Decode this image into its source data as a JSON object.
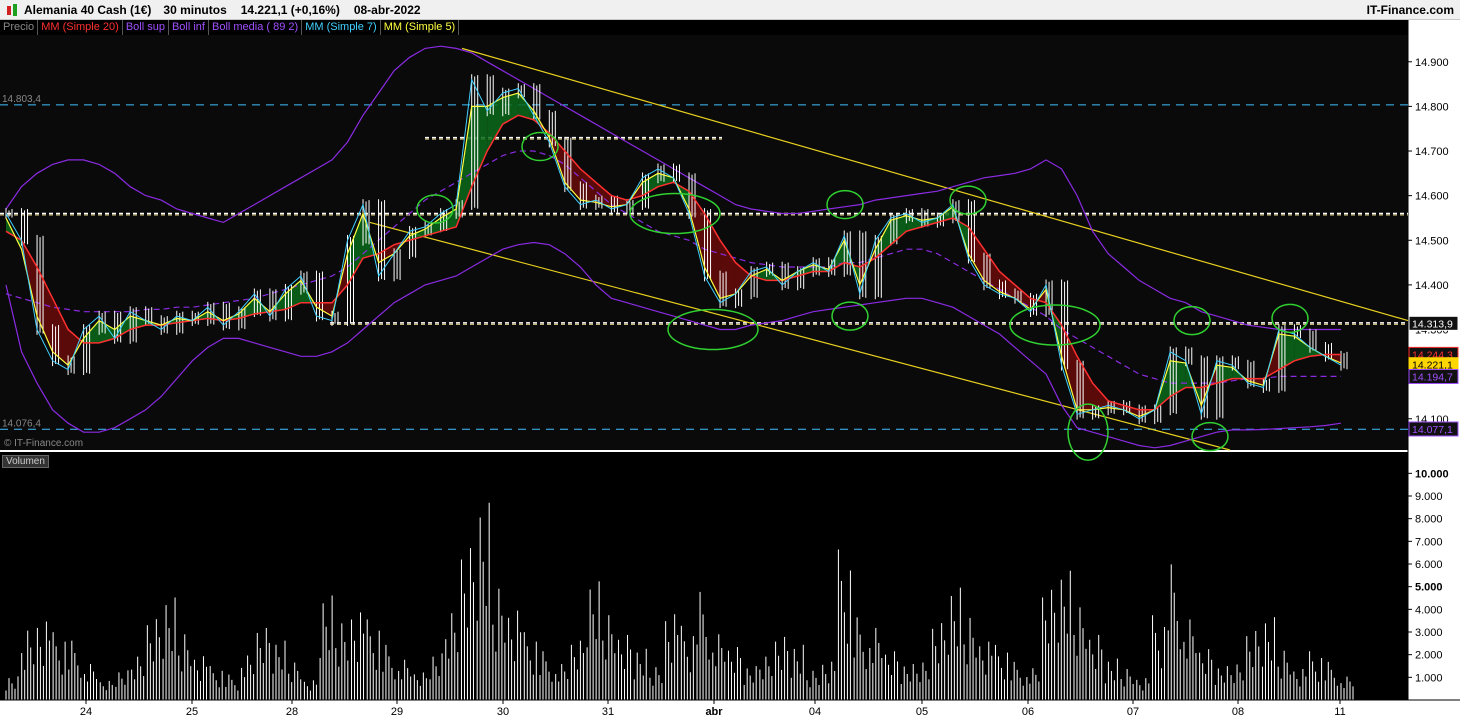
{
  "header": {
    "instrument": "Alemania 40 Cash (1€)",
    "timeframe": "30 minutos",
    "last_change": "14.221,1 (+0,16%)",
    "date": "08-abr-2022",
    "brand": "IT-Finance.com"
  },
  "legend": [
    {
      "label": "Precio",
      "color": "#888888"
    },
    {
      "label": "MM (Simple 20)",
      "color": "#ff3030"
    },
    {
      "label": "Boll sup",
      "color": "#a050ff"
    },
    {
      "label": "Boll inf",
      "color": "#a050ff"
    },
    {
      "label": "Boll media ( 89 2)",
      "color": "#a050ff"
    },
    {
      "label": "MM (Simple 7)",
      "color": "#40d0ff"
    },
    {
      "label": "MM (Simple 5)",
      "color": "#ffff40"
    }
  ],
  "watermark": "© IT-Finance.com",
  "volume_label": "Volumen",
  "chart_data": [
    {
      "type": "line",
      "title": "Alemania 40 Cash (1€) 30 minutos",
      "x_tick_labels": [
        "24",
        "25",
        "28",
        "29",
        "30",
        "31",
        "abr",
        "04",
        "05",
        "06",
        "07",
        "08",
        "11"
      ],
      "y_ticks": [
        14100,
        14200,
        14300,
        14400,
        14500,
        14600,
        14700,
        14800,
        14900
      ],
      "y_tick_labels": [
        "14.100",
        "14.200",
        "14.300",
        "14.400",
        "14.500",
        "14.600",
        "14.700",
        "14.800",
        "14.900"
      ],
      "ylim": [
        14030,
        14960
      ],
      "levels": [
        {
          "label": "14.803,4",
          "value": 14803.4,
          "color": "#40c0ff"
        },
        {
          "label": "14.076,4",
          "value": 14076.4,
          "color": "#40c0ff"
        }
      ],
      "right_badges": [
        {
          "label": "14.313,9",
          "value": 14313.9,
          "color": "#ffffff"
        },
        {
          "label": "14.244,3",
          "value": 14244.3,
          "color": "#ff3030"
        },
        {
          "label": "14.221,1",
          "value": 14221.1,
          "color": "#ffd700"
        },
        {
          "label": "14.194,7",
          "value": 14194.7,
          "color": "#a050ff"
        },
        {
          "label": "14.077,1",
          "value": 14077.1,
          "color": "#a050ff"
        }
      ],
      "series": [
        {
          "name": "Precio",
          "color": "#ffffff",
          "values": [
            14560,
            14500,
            14300,
            14230,
            14210,
            14300,
            14330,
            14280,
            14340,
            14320,
            14300,
            14330,
            14320,
            14350,
            14310,
            14340,
            14380,
            14330,
            14390,
            14420,
            14330,
            14320,
            14500,
            14580,
            14420,
            14470,
            14520,
            14530,
            14560,
            14580,
            14860,
            14790,
            14830,
            14840,
            14780,
            14720,
            14620,
            14580,
            14590,
            14570,
            14580,
            14640,
            14660,
            14640,
            14560,
            14420,
            14360,
            14380,
            14430,
            14440,
            14400,
            14430,
            14450,
            14430,
            14510,
            14380,
            14500,
            14550,
            14560,
            14540,
            14550,
            14580,
            14460,
            14400,
            14380,
            14370,
            14340,
            14400,
            14220,
            14110,
            14120,
            14130,
            14120,
            14100,
            14120,
            14250,
            14230,
            14110,
            14230,
            14220,
            14180,
            14170,
            14300,
            14290,
            14260,
            14240,
            14220
          ]
        },
        {
          "name": "MM (Simple 20)",
          "color": "#ff3030",
          "values": [
            14520,
            14500,
            14440,
            14370,
            14300,
            14270,
            14270,
            14280,
            14300,
            14310,
            14310,
            14315,
            14320,
            14325,
            14320,
            14325,
            14335,
            14340,
            14345,
            14360,
            14360,
            14360,
            14400,
            14460,
            14470,
            14490,
            14500,
            14510,
            14520,
            14530,
            14620,
            14700,
            14760,
            14780,
            14770,
            14740,
            14700,
            14660,
            14630,
            14600,
            14590,
            14600,
            14620,
            14630,
            14610,
            14560,
            14500,
            14450,
            14420,
            14410,
            14410,
            14420,
            14430,
            14430,
            14450,
            14440,
            14460,
            14490,
            14520,
            14530,
            14540,
            14550,
            14530,
            14480,
            14430,
            14400,
            14370,
            14360,
            14310,
            14240,
            14180,
            14140,
            14130,
            14120,
            14120,
            14150,
            14170,
            14170,
            14180,
            14190,
            14190,
            14190,
            14210,
            14230,
            14240,
            14244,
            14244
          ]
        },
        {
          "name": "MM (Simple 5)",
          "color": "#ffff40",
          "values": [
            14550,
            14480,
            14330,
            14250,
            14220,
            14280,
            14320,
            14300,
            14330,
            14320,
            14310,
            14325,
            14320,
            14340,
            14320,
            14335,
            14370,
            14340,
            14380,
            14410,
            14350,
            14330,
            14470,
            14560,
            14450,
            14470,
            14510,
            14525,
            14550,
            14570,
            14800,
            14800,
            14820,
            14830,
            14790,
            14730,
            14630,
            14590,
            14585,
            14575,
            14580,
            14630,
            14650,
            14640,
            14570,
            14440,
            14370,
            14380,
            14420,
            14435,
            14410,
            14430,
            14445,
            14435,
            14500,
            14400,
            14480,
            14545,
            14555,
            14545,
            14550,
            14575,
            14470,
            14410,
            14385,
            14370,
            14345,
            14390,
            14240,
            14120,
            14120,
            14125,
            14120,
            14105,
            14120,
            14230,
            14225,
            14130,
            14220,
            14215,
            14185,
            14175,
            14290,
            14285,
            14260,
            14240,
            14225
          ]
        },
        {
          "name": "Boll media ( 89 2)",
          "color": "#a050ff",
          "values": [
            14380,
            14370,
            14360,
            14350,
            14345,
            14340,
            14340,
            14340,
            14340,
            14345,
            14345,
            14350,
            14350,
            14355,
            14360,
            14365,
            14370,
            14380,
            14390,
            14400,
            14410,
            14420,
            14440,
            14470,
            14500,
            14530,
            14560,
            14590,
            14610,
            14630,
            14650,
            14670,
            14690,
            14700,
            14700,
            14690,
            14670,
            14640,
            14610,
            14580,
            14560,
            14540,
            14520,
            14510,
            14500,
            14480,
            14470,
            14460,
            14450,
            14445,
            14440,
            14440,
            14440,
            14440,
            14450,
            14450,
            14460,
            14470,
            14480,
            14480,
            14470,
            14450,
            14430,
            14410,
            14390,
            14370,
            14350,
            14330,
            14300,
            14280,
            14260,
            14240,
            14220,
            14200,
            14190,
            14180,
            14180,
            14180,
            14180,
            14185,
            14190,
            14190,
            14195,
            14195,
            14195,
            14195,
            14195
          ]
        },
        {
          "name": "Boll sup",
          "color": "#a050ff",
          "values": [
            14570,
            14620,
            14650,
            14670,
            14680,
            14680,
            14670,
            14650,
            14620,
            14600,
            14590,
            14570,
            14560,
            14550,
            14540,
            14560,
            14580,
            14600,
            14620,
            14640,
            14660,
            14680,
            14720,
            14780,
            14830,
            14880,
            14910,
            14930,
            14935,
            14930,
            14920,
            14900,
            14880,
            14860,
            14840,
            14820,
            14800,
            14780,
            14760,
            14740,
            14720,
            14700,
            14680,
            14660,
            14640,
            14620,
            14600,
            14580,
            14570,
            14565,
            14560,
            14560,
            14565,
            14570,
            14575,
            14580,
            14590,
            14595,
            14600,
            14605,
            14610,
            14620,
            14630,
            14640,
            14645,
            14650,
            14660,
            14680,
            14660,
            14600,
            14520,
            14470,
            14440,
            14410,
            14390,
            14370,
            14360,
            14340,
            14330,
            14320,
            14310,
            14305,
            14300,
            14300,
            14300,
            14300,
            14300
          ]
        },
        {
          "name": "Boll inf",
          "color": "#a050ff",
          "values": [
            14400,
            14250,
            14180,
            14120,
            14090,
            14070,
            14070,
            14080,
            14100,
            14120,
            14150,
            14190,
            14230,
            14260,
            14280,
            14280,
            14270,
            14260,
            14250,
            14240,
            14240,
            14250,
            14270,
            14300,
            14330,
            14360,
            14380,
            14400,
            14410,
            14420,
            14440,
            14460,
            14480,
            14490,
            14495,
            14490,
            14470,
            14440,
            14400,
            14370,
            14360,
            14350,
            14340,
            14330,
            14320,
            14310,
            14300,
            14300,
            14310,
            14315,
            14320,
            14330,
            14340,
            14345,
            14350,
            14355,
            14360,
            14365,
            14370,
            14370,
            14360,
            14350,
            14330,
            14310,
            14290,
            14260,
            14230,
            14200,
            14130,
            14080,
            14070,
            14060,
            14050,
            14040,
            14035,
            14040,
            14050,
            14060,
            14070,
            14075,
            14075,
            14076,
            14078,
            14080,
            14082,
            14085,
            14090
          ]
        }
      ],
      "channel_upper": {
        "x": [
          462,
          1408
        ],
        "y": [
          14930,
          14320
        ]
      },
      "channel_lower": {
        "x": [
          370,
          1230
        ],
        "y": [
          14540,
          14030
        ]
      },
      "dashed_levels": [
        14560,
        14315,
        14730
      ],
      "circles": [
        {
          "x": 435,
          "y": 14570
        },
        {
          "x": 540,
          "y": 14710
        },
        {
          "x": 675,
          "y": 14560
        },
        {
          "x": 713,
          "y": 14300
        },
        {
          "x": 845,
          "y": 14580
        },
        {
          "x": 850,
          "y": 14330
        },
        {
          "x": 968,
          "y": 14590
        },
        {
          "x": 1055,
          "y": 14310
        },
        {
          "x": 1088,
          "y": 14070
        },
        {
          "x": 1192,
          "y": 14320
        },
        {
          "x": 1210,
          "y": 14060
        },
        {
          "x": 1290,
          "y": 14325
        }
      ]
    },
    {
      "type": "bar",
      "title": "Volumen",
      "y_ticks": [
        1000,
        2000,
        3000,
        4000,
        5000,
        6000,
        7000,
        8000,
        9000,
        10000
      ],
      "y_tick_labels": [
        "1.000",
        "2.000",
        "3.000",
        "4.000",
        "5.000",
        "6.000",
        "7.000",
        "8.000",
        "9.000",
        "10.000"
      ],
      "ylim": [
        0,
        10500
      ],
      "values": [
        1200,
        3800,
        4300,
        3200,
        2800,
        1700,
        900,
        1400,
        2200,
        4100,
        5200,
        3600,
        2400,
        1600,
        1200,
        2100,
        3400,
        2800,
        1900,
        1000,
        5300,
        4200,
        4800,
        3800,
        2600,
        1900,
        1300,
        2200,
        4400,
        7700,
        10000,
        6100,
        4900,
        3200,
        2300,
        1700,
        2800,
        5600,
        4300,
        3300,
        2600,
        1800,
        4700,
        3500,
        5100,
        3100,
        2500,
        1600,
        2200,
        3200,
        2800,
        1600,
        2100,
        7100,
        3900,
        3400,
        2300,
        1700,
        1900,
        3900,
        5700,
        4500,
        3200,
        2600,
        1800,
        1500,
        5200,
        6100,
        4700,
        3300,
        2100,
        1700,
        1200,
        4000,
        6400,
        3800,
        2400,
        1600,
        1800,
        3500,
        4200,
        2700,
        1700,
        2300,
        1800,
        1100
      ]
    }
  ]
}
